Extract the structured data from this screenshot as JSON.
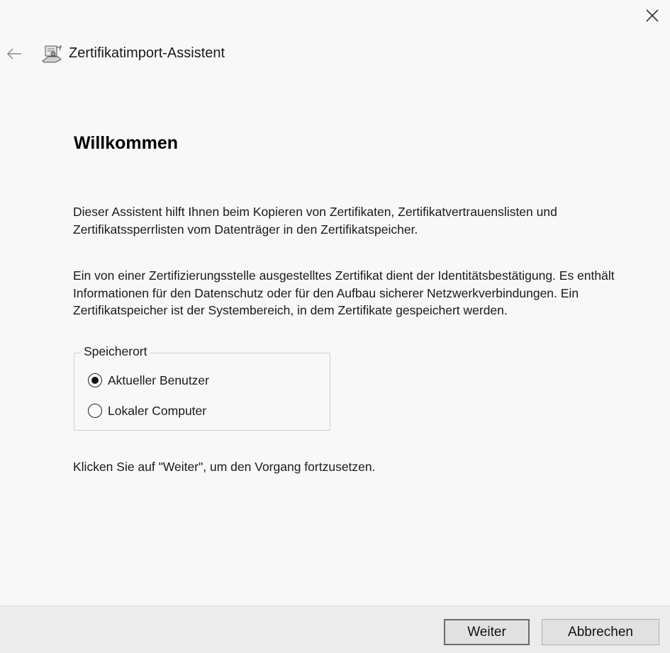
{
  "window": {
    "close_icon": "close-icon",
    "back_icon": "back-arrow-icon"
  },
  "header": {
    "icon": "certificate-wizard-icon",
    "title": "Zertifikatimport-Assistent"
  },
  "main": {
    "heading": "Willkommen",
    "paragraph1": "Dieser Assistent hilft Ihnen beim Kopieren von Zertifikaten, Zertifikatvertrauenslisten und Zertifikatssperrlisten vom Datenträger in den Zertifikatspeicher.",
    "paragraph2": "Ein von einer Zertifizierungsstelle ausgestelltes Zertifikat dient der Identitätsbestätigung. Es enthält Informationen für den Datenschutz oder für den Aufbau sicherer Netzwerkverbindungen. Ein Zertifikatspeicher ist der Systembereich, in dem Zertifikate gespeichert werden.",
    "storage_location": {
      "legend": "Speicherort",
      "options": [
        {
          "label": "Aktueller Benutzer",
          "selected": true
        },
        {
          "label": "Lokaler Computer",
          "selected": false
        }
      ]
    },
    "instruction": "Klicken Sie auf \"Weiter\", um den Vorgang fortzusetzen."
  },
  "footer": {
    "next_label": "Weiter",
    "cancel_label": "Abbrechen"
  }
}
